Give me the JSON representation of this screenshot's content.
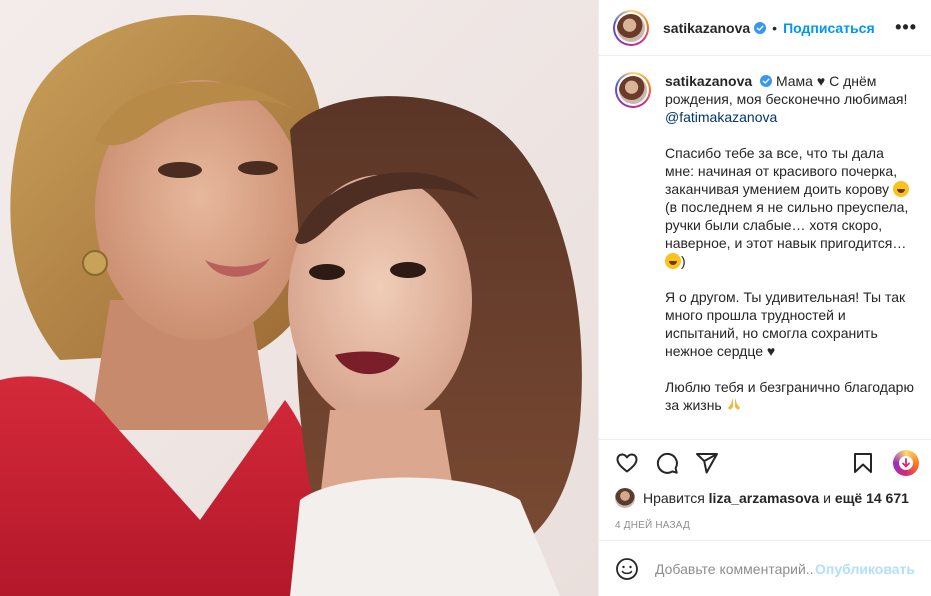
{
  "post": {
    "username": "satikazanova",
    "follow_label": "Подписаться",
    "more_label": "•••"
  },
  "caption": {
    "username": "satikazanova",
    "line_title": "Мама ♥",
    "line_1": "С днём рождения, моя бесконечно любимая! ",
    "mention": "@fatimakazanova",
    "para_2": "Спасибо тебе за все, что ты дала мне: начиная от красивого почерка, заканчивая умением доить корову ",
    "para_2b": " (в последнем я не сильно преуспела, ручки были слабые… хотя скоро, наверное, и этот навык пригодится…",
    "para_2c": ")",
    "para_3": "Я о другом. Ты удивительная! Ты так много прошла трудностей и испытаний, но смогла сохранить нежное сердце ♥",
    "para_4": "Люблю тебя и безгранично благодарю за жизнь "
  },
  "likes": {
    "prefix": "Нравится",
    "user": "liza_arzamasova",
    "middle": "и",
    "others": "ещё 14 671"
  },
  "timestamp": "4 ДНЕЙ НАЗАД",
  "comment_box": {
    "placeholder": "Добавьте комментарий...",
    "publish_label": "Опубликовать"
  },
  "icons": {
    "like": "heart-icon",
    "comment": "comment-icon",
    "share": "share-icon",
    "save": "bookmark-icon",
    "promo": "promo-icon",
    "emoji": "smile-icon",
    "verified": "verified-icon"
  },
  "colors": {
    "link": "#0095f6",
    "mention": "#00376b",
    "muted": "#8e8e8e",
    "publish_disabled": "#b2dffc"
  }
}
